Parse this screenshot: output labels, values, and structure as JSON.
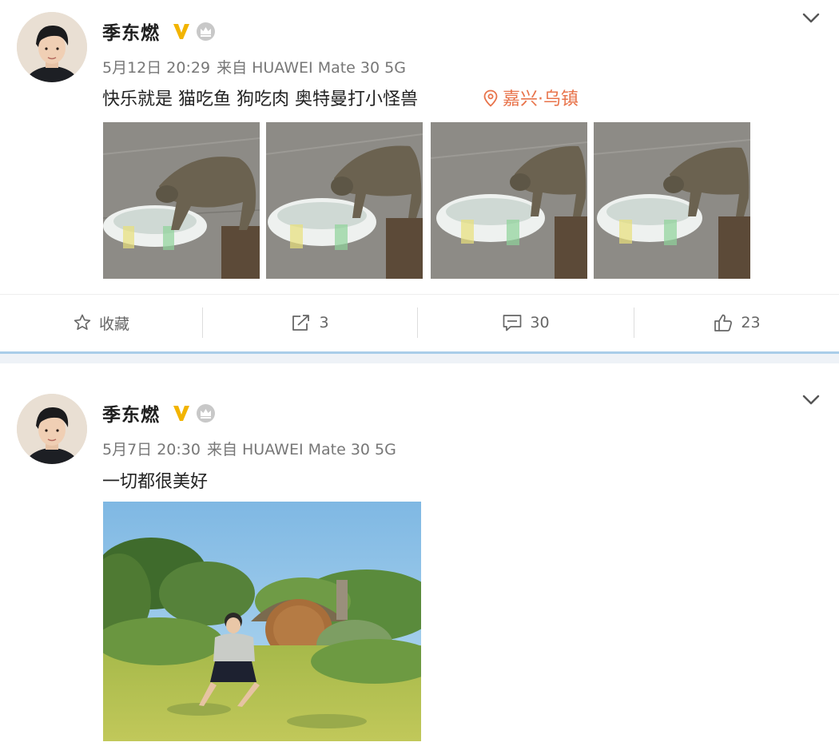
{
  "posts": [
    {
      "author": "季东燃",
      "date": "5月12日 20:29",
      "source": "来自 HUAWEI Mate 30 5G",
      "text": "快乐就是 猫吃鱼 狗吃肉 奥特曼打小怪兽",
      "location": "嘉兴·乌镇",
      "images": [
        "cat-photo-1",
        "cat-photo-2",
        "cat-photo-3",
        "cat-photo-4"
      ],
      "actions": {
        "favorite_label": "收藏",
        "repost_count": "3",
        "comment_count": "30",
        "like_count": "23"
      }
    },
    {
      "author": "季东燃",
      "date": "5月7日 20:30",
      "source": "来自 HUAWEI Mate 30 5G",
      "text": "一切都很美好"
    }
  ],
  "colors": {
    "location": "#e8734a",
    "separator": "#a9cde9",
    "verified_badge": "#f2b400",
    "crown": "#a0a0a0"
  },
  "icons": [
    "verified-icon",
    "crown-icon",
    "chevron-down-icon",
    "location-pin-icon",
    "star-icon",
    "share-icon",
    "comment-icon",
    "like-icon"
  ]
}
